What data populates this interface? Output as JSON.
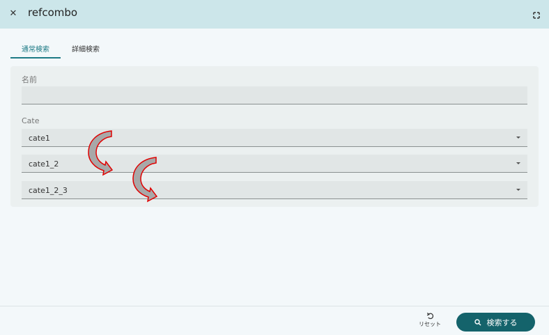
{
  "header": {
    "title": "refcombo"
  },
  "tabs": [
    {
      "label": "通常検索",
      "active": true
    },
    {
      "label": "詳細検索",
      "active": false
    }
  ],
  "form": {
    "name_label": "名前",
    "name_value": "",
    "cate_label": "Cate",
    "selects": [
      {
        "value": "cate1"
      },
      {
        "value": "cate1_2"
      },
      {
        "value": "cate1_2_3"
      }
    ]
  },
  "footer": {
    "reset_label": "リセット",
    "search_label": "検索する"
  },
  "colors": {
    "header_bg": "#cce6ea",
    "accent": "#1d7a85",
    "search_button": "#14636b",
    "arrow_stroke": "#e00000",
    "arrow_fill": "#a8a8a8"
  },
  "icons": [
    "close-icon",
    "fullscreen-icon",
    "chevron-down-icon",
    "reset-icon",
    "search-icon",
    "curved-arrow-icon"
  ]
}
